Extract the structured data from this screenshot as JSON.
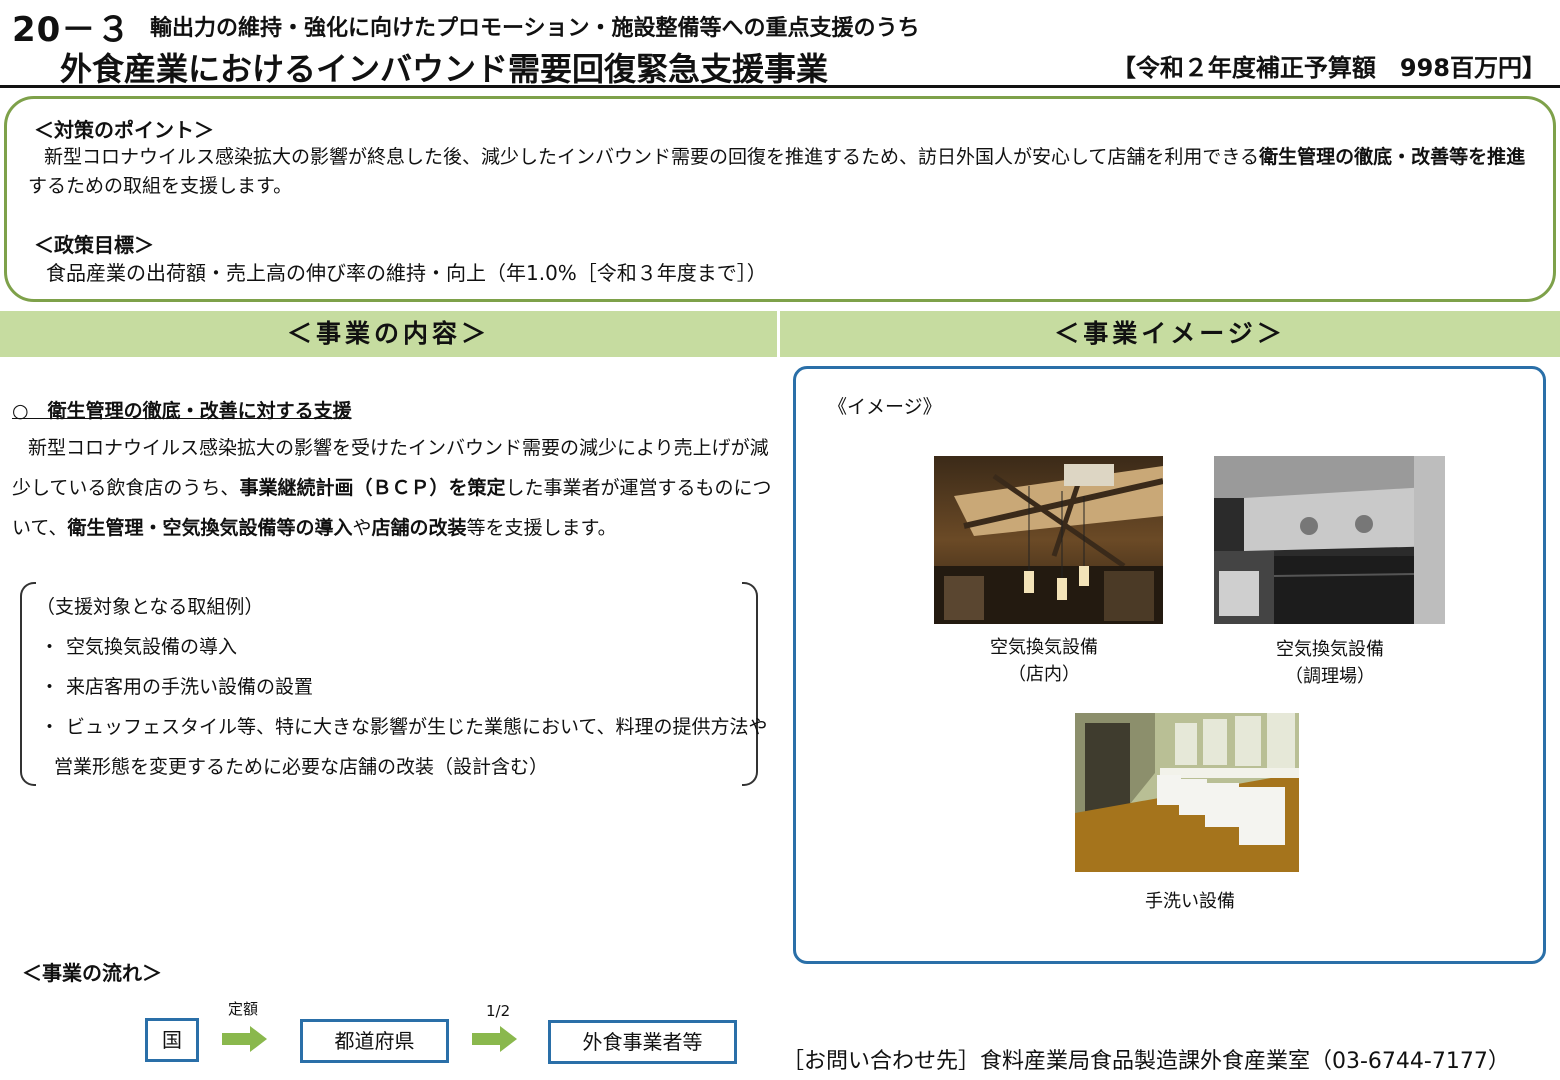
{
  "header": {
    "number": "20－３",
    "subtitle": "輸出力の維持・強化に向けたプロモーション・施設整備等への重点支援のうち",
    "title": "外食産業におけるインバウンド需要回復緊急支援事業",
    "budget": "【令和２年度補正予算額　998百万円】"
  },
  "points": {
    "heading": "＜対策のポイント＞",
    "text_a": "新型コロナウイルス感染拡大の影響が終息した後、減少したインバウンド需要の回復を推進するため、訪日外国人が安心して店舗を利用できる",
    "text_b": "衛生管理の徹底・改善等を推進",
    "text_c": "するための取組を支援します。",
    "goal_heading": "＜政策目標＞",
    "goal_text": "食品産業の出荷額・売上高の伸び率の維持・向上（年1.0%［令和３年度まで］）"
  },
  "content": {
    "band_label": "＜事業の内容＞",
    "section_heading": "○　衛生管理の徹底・改善に対する支援",
    "p1": "新型コロナウイルス感染拡大の影響を受けたインバウンド需要の減少により売上げが減少している飲食店のうち、",
    "p2": "事業継続計画（ＢＣＰ）を策定",
    "p3": "した事業者が運営するものについて、",
    "p4": "衛生管理・空気換気設備等の導入",
    "p5": "や",
    "p6": "店舗の改装",
    "p7": "等を支援します。",
    "examples_heading": "（支援対象となる取組例）",
    "examples": [
      "空気換気設備の導入",
      "来店客用の手洗い設備の設置",
      "ビュッフェスタイル等、特に大きな影響が生じた業態において、料理の提供方法や"
    ],
    "example_cont": "営業形態を変更するために必要な店舗の改装（設計含む）",
    "bullet": "・"
  },
  "image_section": {
    "band_label": "＜事業イメージ＞",
    "heading": "《イメージ》",
    "cap1_a": "空気換気設備",
    "cap1_b": "（店内）",
    "cap2_a": "空気換気設備",
    "cap2_b": "（調理場）",
    "cap3": "手洗い設備"
  },
  "flow": {
    "heading": "＜事業の流れ＞",
    "node1": "国",
    "arrow1": "定額",
    "node2": "都道府県",
    "arrow2": "1/2",
    "node3": "外食事業者等",
    "arrow_color": "#8ab84d",
    "box_color": "#2a6fa8"
  },
  "contact": "［お問い合わせ先］食料産業局食品製造課外食産業室（03-6744-7177）"
}
